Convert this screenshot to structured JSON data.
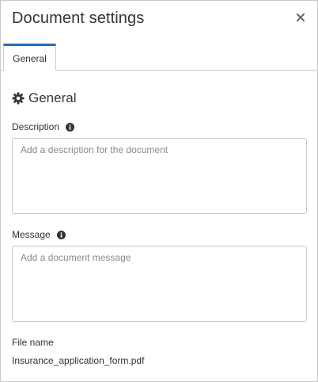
{
  "dialog": {
    "title": "Document settings",
    "close_icon": "close-icon"
  },
  "tabs": [
    {
      "label": "General",
      "active": true
    }
  ],
  "section": {
    "title": "General",
    "icon": "gear-icon"
  },
  "description": {
    "label": "Description",
    "info_icon": "info-icon",
    "placeholder": "Add a description for the document",
    "value": ""
  },
  "message": {
    "label": "Message",
    "info_icon": "info-icon",
    "placeholder": "Add a document message",
    "value": ""
  },
  "file": {
    "label": "File name",
    "value": "Insurance_application_form.pdf"
  },
  "colors": {
    "accent": "#1f6fb5",
    "border": "#c8c8c8",
    "text": "#333333",
    "placeholder": "#8a8a8a"
  }
}
